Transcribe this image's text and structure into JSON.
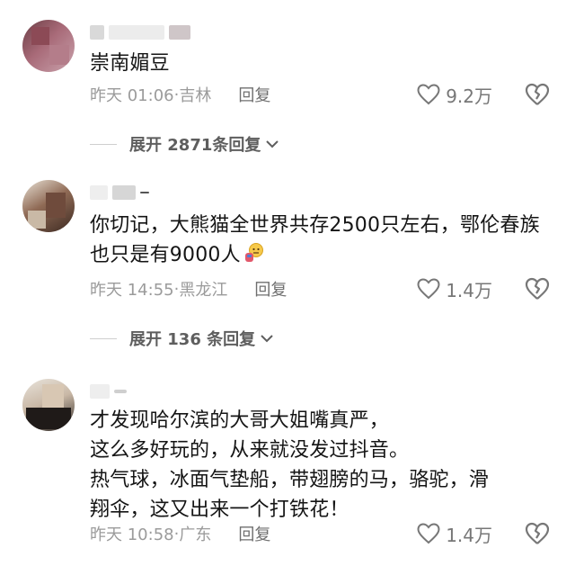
{
  "comments": [
    {
      "text": "崇南媚豆",
      "time": "昨天 01:06",
      "location": "吉林",
      "reply_label": "回复",
      "likes": "9.2万",
      "expand_label": "展开 2871条回复"
    },
    {
      "text": "你切记，大熊猫全世界共存2500只左右，鄂伦春族也只是有9000人",
      "time": "昨天 14:55",
      "location": "黑龙江",
      "reply_label": "回复",
      "likes": "1.4万",
      "expand_label": "展开 136 条回复"
    },
    {
      "text_lines": [
        "才发现哈尔滨的大哥大姐嘴真严，",
        "这么多好玩的，从来就没发过抖音。",
        "热气球，冰面气垫船，带翅膀的马，骆驼，滑",
        "翔伞，这又出来一个打铁花！"
      ],
      "time": "昨天 10:58",
      "location": "广东",
      "reply_label": "回复",
      "likes": "1.4万"
    }
  ],
  "icons": {
    "like": "heart-outline-icon",
    "dislike": "broken-heart-icon",
    "expand": "chevron-down-icon",
    "emoji": "speechless-emoji-icon"
  },
  "colors": {
    "text": "#151515",
    "meta": "#9b9b9b",
    "icon": "#777777"
  },
  "separator": "·"
}
